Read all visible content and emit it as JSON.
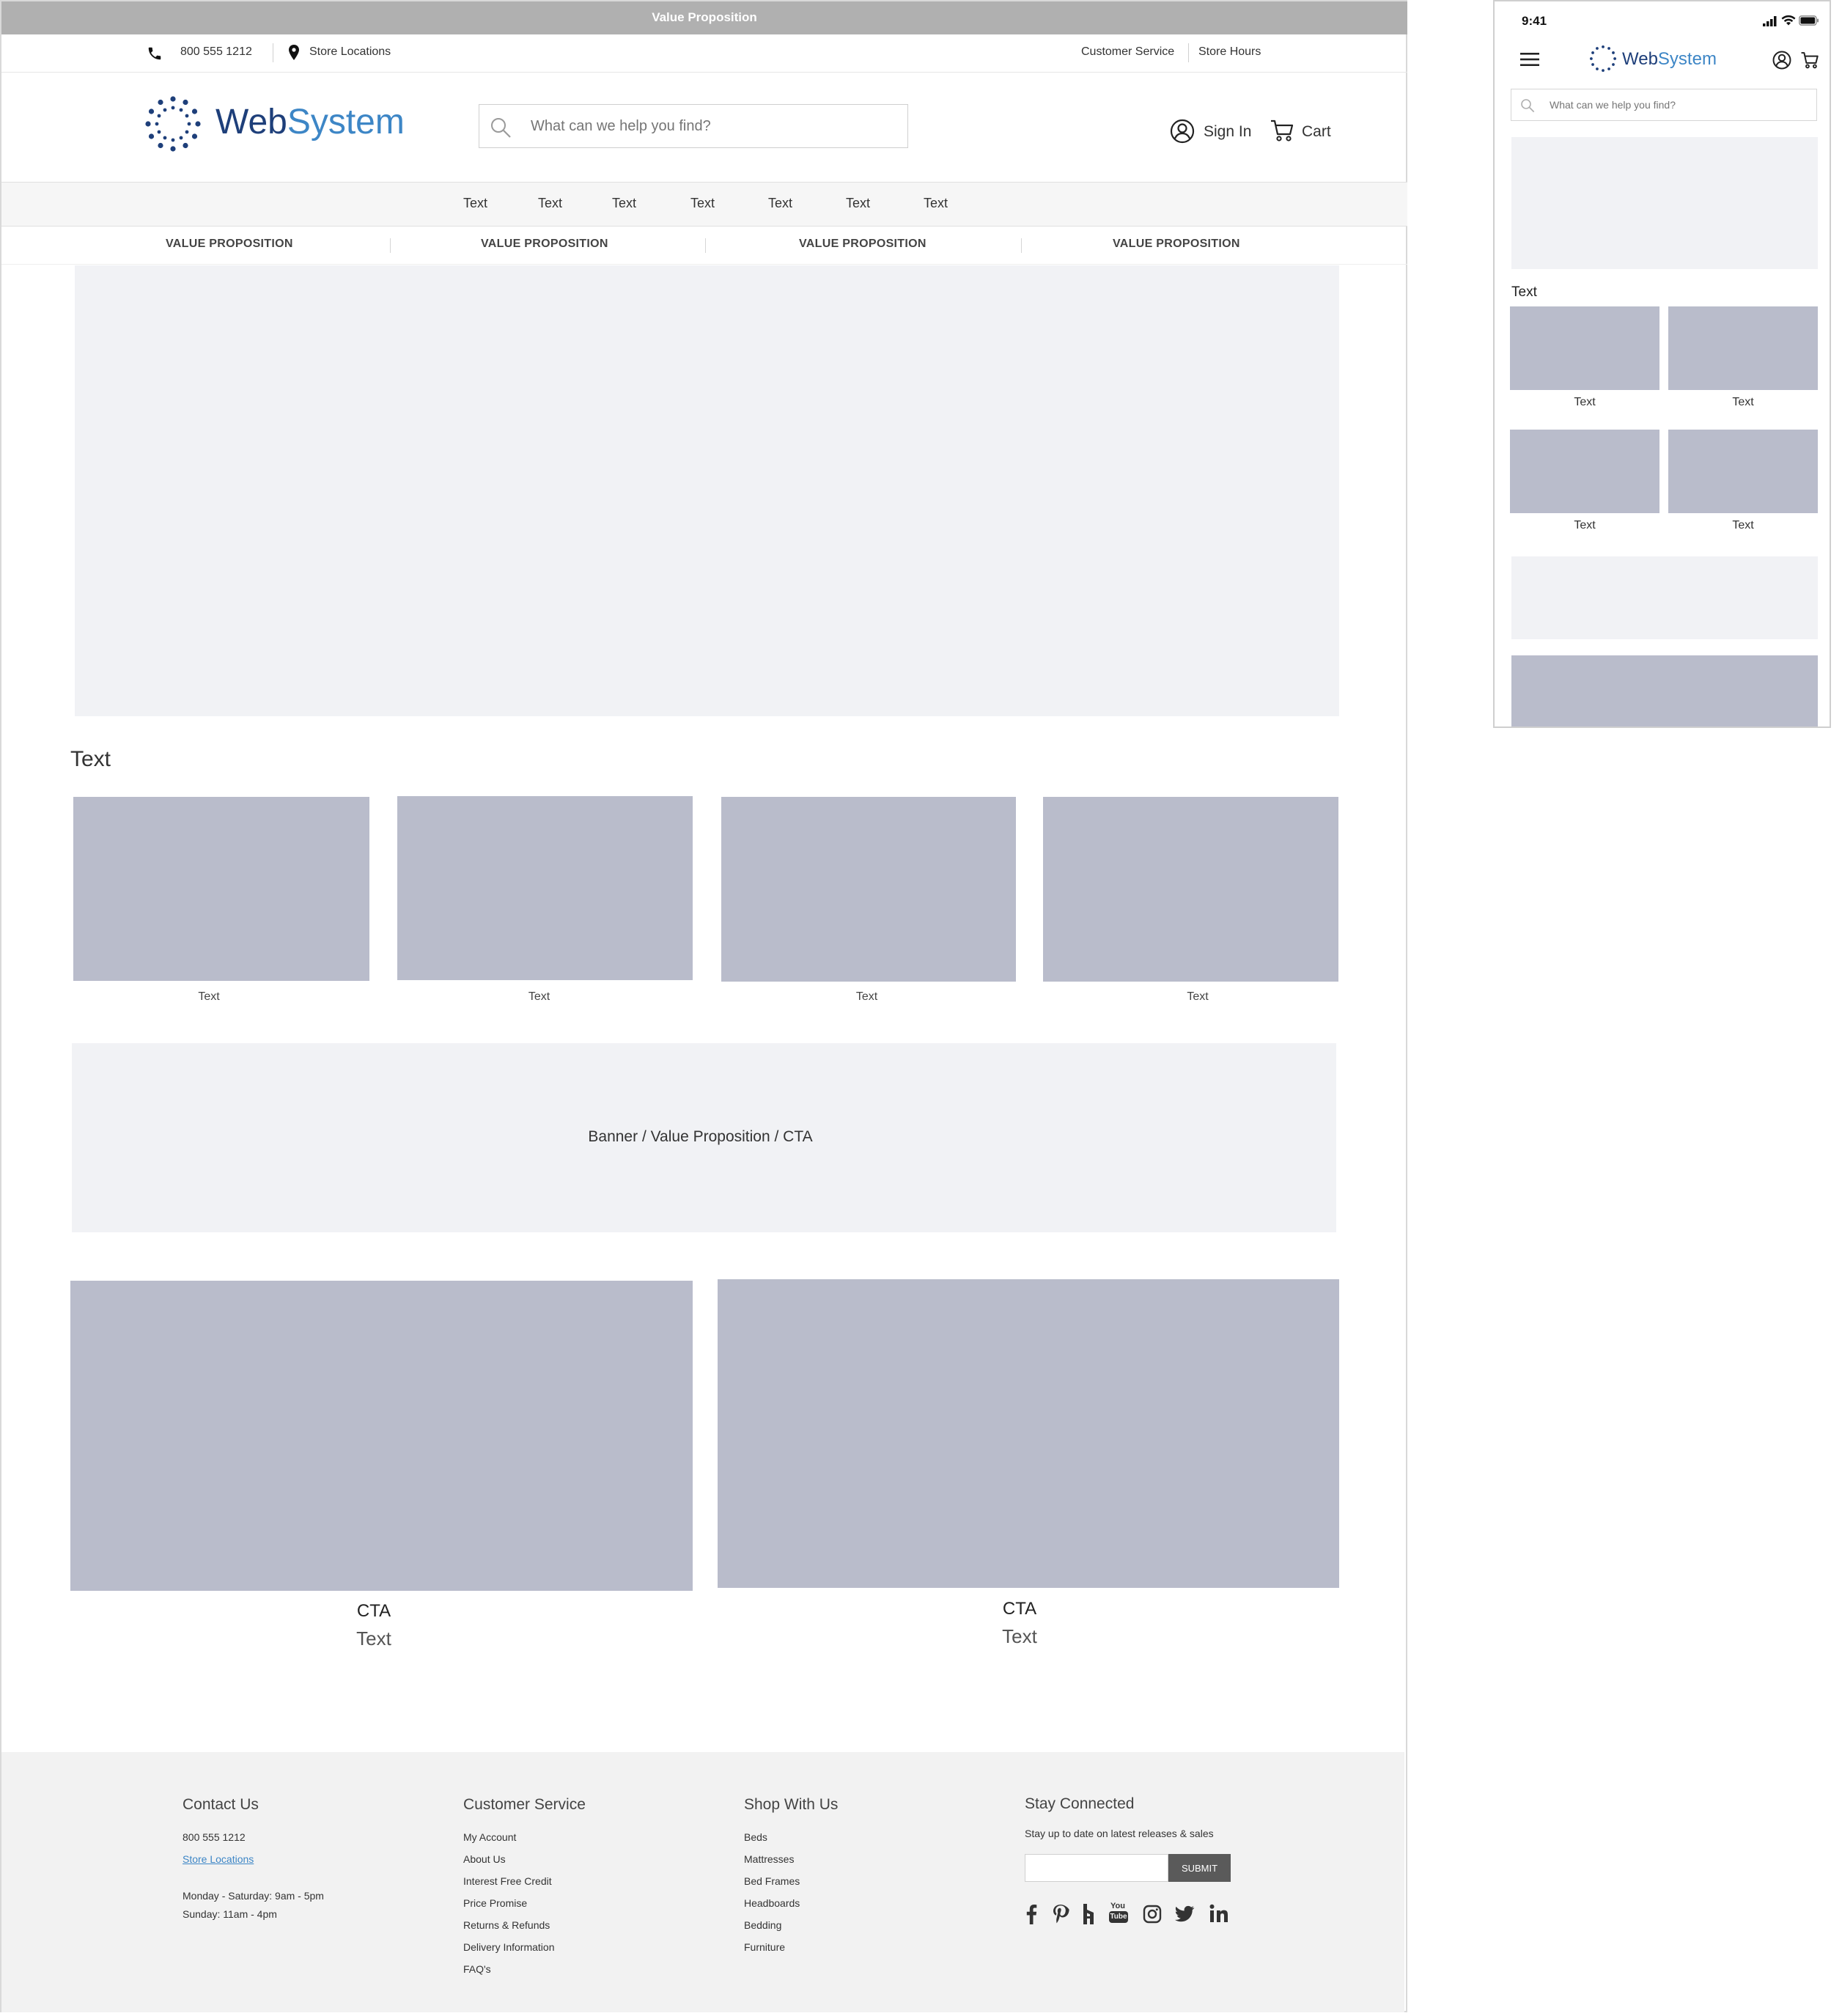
{
  "topbar": {
    "text": "Value Proposition"
  },
  "utility": {
    "phone": "800 555 1212",
    "store_locations": "Store Locations",
    "customer_service": "Customer Service",
    "store_hours": "Store Hours"
  },
  "brand": {
    "name_a": "Web",
    "name_b": "System",
    "color_dark": "#1e3f7a",
    "color_light": "#3d86c6"
  },
  "search": {
    "placeholder": "What can we help you find?"
  },
  "account": {
    "sign_in": "Sign In",
    "cart": "Cart"
  },
  "nav": {
    "items": [
      "Text",
      "Text",
      "Text",
      "Text",
      "Text",
      "Text",
      "Text"
    ]
  },
  "value_props": [
    "VALUE PROPOSITION",
    "VALUE PROPOSITION",
    "VALUE PROPOSITION",
    "VALUE PROPOSITION"
  ],
  "section": {
    "title": "Text",
    "tiles": [
      "Text",
      "Text",
      "Text",
      "Text"
    ]
  },
  "banner": {
    "text": "Banner / Value Proposition / CTA"
  },
  "promos": [
    {
      "cta": "CTA",
      "text": "Text"
    },
    {
      "cta": "CTA",
      "text": "Text"
    }
  ],
  "footer": {
    "contact": {
      "title": "Contact Us",
      "phone": "800 555 1212",
      "store_locations": "Store Locations",
      "hours_1": "Monday - Saturday:  9am - 5pm",
      "hours_2": "Sunday:  11am - 4pm"
    },
    "customer_service": {
      "title": "Customer Service",
      "links": [
        "My Account",
        "About Us",
        "Interest Free Credit",
        "Price Promise",
        "Returns & Refunds",
        "Delivery Information",
        "FAQ's"
      ]
    },
    "shop": {
      "title": "Shop With Us",
      "links": [
        "Beds",
        "Mattresses",
        "Bed Frames",
        "Headboards",
        "Bedding",
        "Furniture"
      ]
    },
    "connect": {
      "title": "Stay Connected",
      "subtitle": "Stay up to date on latest releases & sales",
      "submit": "SUBMIT",
      "social": [
        "facebook-icon",
        "pinterest-icon",
        "houzz-icon",
        "youtube-icon",
        "instagram-icon",
        "twitter-icon",
        "linkedin-icon"
      ],
      "youtube_a": "You",
      "youtube_b": "Tube"
    }
  },
  "mobile": {
    "time": "9:41",
    "search_placeholder": "What can we help you find?",
    "section_title": "Text",
    "tiles": [
      "Text",
      "Text",
      "Text",
      "Text"
    ]
  }
}
